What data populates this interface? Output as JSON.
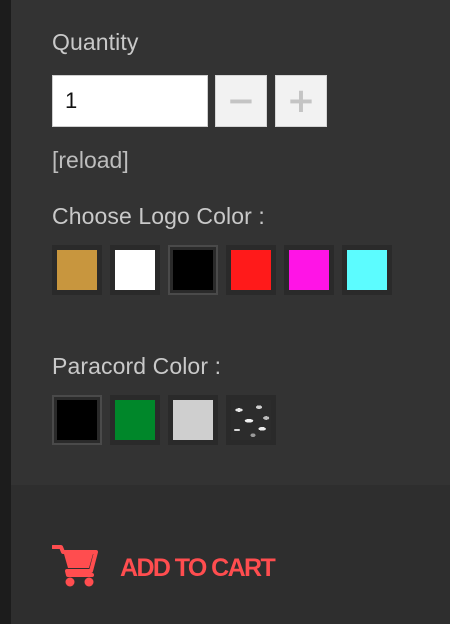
{
  "quantity": {
    "label": "Quantity",
    "value": "1",
    "decrement_glyph": "−",
    "increment_glyph": "+"
  },
  "reload_link": "[reload]",
  "logo_color": {
    "label": "Choose Logo Color :",
    "swatches": [
      {
        "name": "gold",
        "color": "#c8963e",
        "selected": false
      },
      {
        "name": "white",
        "color": "#ffffff",
        "selected": false
      },
      {
        "name": "black",
        "color": "#000000",
        "selected": true
      },
      {
        "name": "red",
        "color": "#ff1a1a",
        "selected": false
      },
      {
        "name": "magenta",
        "color": "#ff14e6",
        "selected": false
      },
      {
        "name": "cyan",
        "color": "#5cfcff",
        "selected": false
      }
    ]
  },
  "paracord_color": {
    "label": "Paracord Color :",
    "swatches": [
      {
        "name": "black",
        "color": "#000000",
        "selected": true
      },
      {
        "name": "green",
        "color": "#00872a",
        "selected": false
      },
      {
        "name": "light-gray",
        "color": "#cfcfcf",
        "selected": false
      },
      {
        "name": "camo",
        "color": "camo",
        "selected": false
      }
    ]
  },
  "cart": {
    "label": "ADD TO CART",
    "icon": "shopping-cart-icon",
    "color": "#ff4d4f"
  }
}
